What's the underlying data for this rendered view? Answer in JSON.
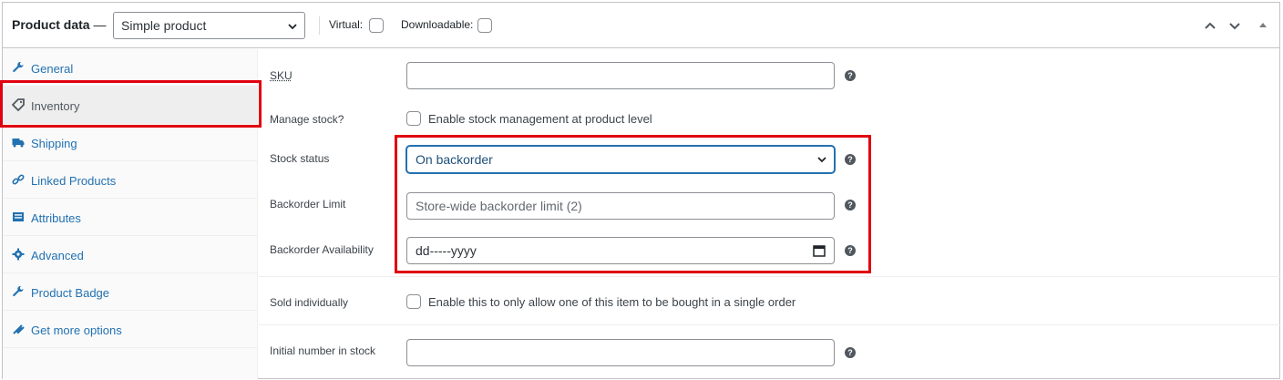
{
  "header": {
    "title": "Product data",
    "title_dash": "—",
    "product_type": "Simple product",
    "virtual_label": "Virtual:",
    "downloadable_label": "Downloadable:"
  },
  "tabs": [
    {
      "label": "General",
      "icon": "wrench-icon"
    },
    {
      "label": "Inventory",
      "icon": "tag-icon",
      "active": true
    },
    {
      "label": "Shipping",
      "icon": "truck-icon"
    },
    {
      "label": "Linked Products",
      "icon": "link-icon"
    },
    {
      "label": "Attributes",
      "icon": "list-icon"
    },
    {
      "label": "Advanced",
      "icon": "gear-icon"
    },
    {
      "label": "Product Badge",
      "icon": "wrench-icon"
    },
    {
      "label": "Get more options",
      "icon": "plug-icon"
    }
  ],
  "inventory": {
    "sku": {
      "label": "SKU",
      "value": ""
    },
    "manage_stock": {
      "label": "Manage stock?",
      "checkbox_label": "Enable stock management at product level"
    },
    "stock_status": {
      "label": "Stock status",
      "value": "On backorder"
    },
    "backorder_limit": {
      "label": "Backorder Limit",
      "placeholder": "Store-wide backorder limit (2)"
    },
    "backorder_availability": {
      "label": "Backorder Availability",
      "value": "dd-----yyyy"
    },
    "sold_individually": {
      "label": "Sold individually",
      "checkbox_label": "Enable this to only allow one of this item to be bought in a single order"
    },
    "initial_stock": {
      "label": "Initial number in stock",
      "value": ""
    }
  },
  "colors": {
    "link": "#2271b1",
    "highlight": "#e0000f",
    "border": "#c3c4c7"
  }
}
